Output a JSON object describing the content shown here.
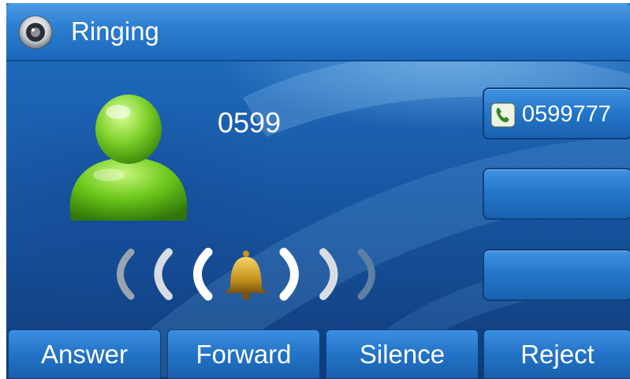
{
  "header": {
    "title": "Ringing",
    "icon": "speaker-icon"
  },
  "caller": {
    "number": "0599",
    "avatar_icon": "contact-avatar-icon"
  },
  "ring_indicator": {
    "icon": "bell-icon"
  },
  "lines": [
    {
      "label": "0599777",
      "icon": "phone-icon"
    },
    {
      "label": ""
    },
    {
      "label": ""
    }
  ],
  "softkeys": [
    {
      "label": "Answer"
    },
    {
      "label": "Forward"
    },
    {
      "label": "Silence"
    },
    {
      "label": "Reject"
    }
  ],
  "colors": {
    "background": "#1b5fae",
    "button": "#2373c6",
    "avatar": "#6cc71a",
    "bell": "#c8961e"
  }
}
